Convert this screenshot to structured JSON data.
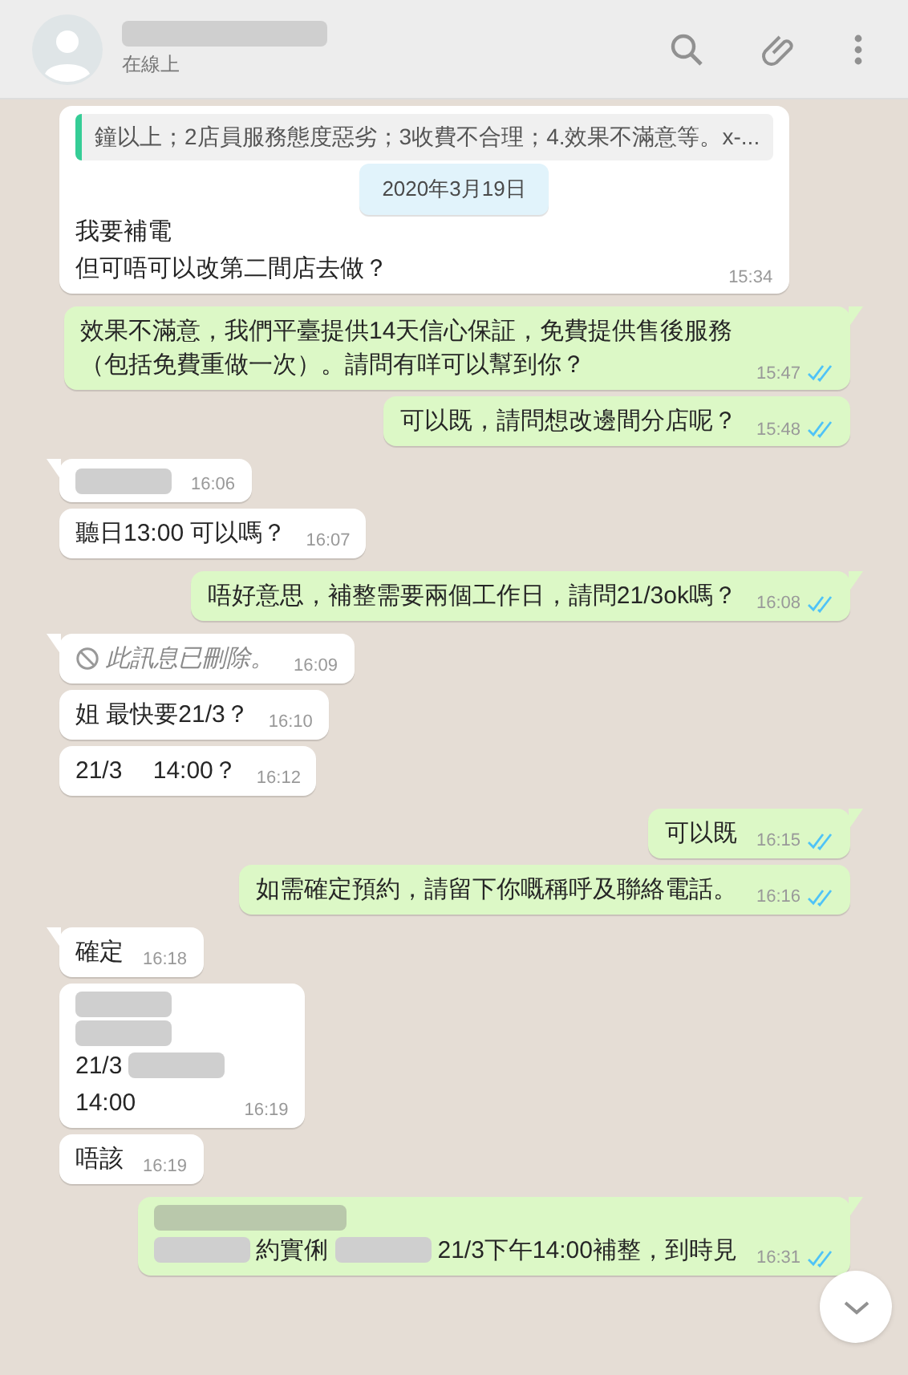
{
  "header": {
    "status": "在線上"
  },
  "date_chip": "2020年3月19日",
  "messages": [
    {
      "kind": "incoming",
      "tail": false,
      "quote": "鐘以上；2店員服務態度惡劣；3收費不合理；4.效果不滿意等。x-...",
      "lines": [
        [
          {
            "kind": "text",
            "text": "我要補電"
          }
        ],
        [
          {
            "kind": "text",
            "text": "但可唔可以改第二間店去做？"
          }
        ]
      ],
      "time": "15:34"
    },
    {
      "kind": "outgoing",
      "tail": true,
      "read": true,
      "lines": [
        [
          {
            "kind": "text",
            "text": "效果不滿意，我們平臺提供14天信心保証，免費提供售後服務（包括免費重做一次）。請問有咩可以幫到你？"
          }
        ]
      ],
      "time": "15:47"
    },
    {
      "kind": "outgoing",
      "tail": false,
      "read": true,
      "lines": [
        [
          {
            "kind": "text",
            "text": "可以既，請問想改邊間分店呢？"
          }
        ]
      ],
      "time": "15:48"
    },
    {
      "kind": "incoming",
      "tail": true,
      "lines": [
        [
          {
            "kind": "redacted"
          }
        ]
      ],
      "time": "16:06"
    },
    {
      "kind": "incoming",
      "tail": false,
      "lines": [
        [
          {
            "kind": "text",
            "text": "聽日13:00 可以嗎？"
          }
        ]
      ],
      "time": "16:07"
    },
    {
      "kind": "outgoing",
      "tail": true,
      "read": true,
      "lines": [
        [
          {
            "kind": "text",
            "text": "唔好意思，補整需要兩個工作日，請問21/3ok嗎？"
          }
        ]
      ],
      "time": "16:08"
    },
    {
      "kind": "incoming",
      "tail": true,
      "lines": [
        [
          {
            "kind": "deleted",
            "text": "此訊息已刪除。"
          }
        ]
      ],
      "time": "16:09"
    },
    {
      "kind": "incoming",
      "tail": false,
      "lines": [
        [
          {
            "kind": "text",
            "text": "姐 最快要21/3？"
          }
        ]
      ],
      "time": "16:10"
    },
    {
      "kind": "incoming",
      "tail": false,
      "lines": [
        [
          {
            "kind": "text",
            "text": "21/3　 14:00？"
          }
        ]
      ],
      "time": "16:12"
    },
    {
      "kind": "outgoing",
      "tail": true,
      "read": true,
      "lines": [
        [
          {
            "kind": "text",
            "text": "可以既"
          }
        ]
      ],
      "time": "16:15"
    },
    {
      "kind": "outgoing",
      "tail": false,
      "read": true,
      "lines": [
        [
          {
            "kind": "text",
            "text": "如需確定預約，請留下你嘅稱呼及聯絡電話。"
          }
        ]
      ],
      "time": "16:16"
    },
    {
      "kind": "incoming",
      "tail": true,
      "lines": [
        [
          {
            "kind": "text",
            "text": "確定"
          }
        ]
      ],
      "time": "16:18"
    },
    {
      "kind": "incoming",
      "tail": false,
      "lines": [
        [
          {
            "kind": "redacted"
          }
        ],
        [
          {
            "kind": "redacted"
          }
        ],
        [
          {
            "kind": "text",
            "text": "21/3"
          },
          {
            "kind": "redacted"
          }
        ],
        [
          {
            "kind": "text",
            "text": "14:00"
          }
        ]
      ],
      "time": "16:19"
    },
    {
      "kind": "incoming",
      "tail": false,
      "lines": [
        [
          {
            "kind": "text",
            "text": "唔該"
          }
        ]
      ],
      "time": "16:19"
    },
    {
      "kind": "outgoing",
      "tail": true,
      "read": true,
      "lines": [
        [
          {
            "kind": "redacted"
          }
        ],
        [
          {
            "kind": "redacted"
          },
          {
            "kind": "text",
            "text": "約實俐"
          },
          {
            "kind": "redacted"
          },
          {
            "kind": "text",
            "text": "21/3下午14:00補整，到時見"
          }
        ]
      ],
      "time": "16:31"
    }
  ]
}
